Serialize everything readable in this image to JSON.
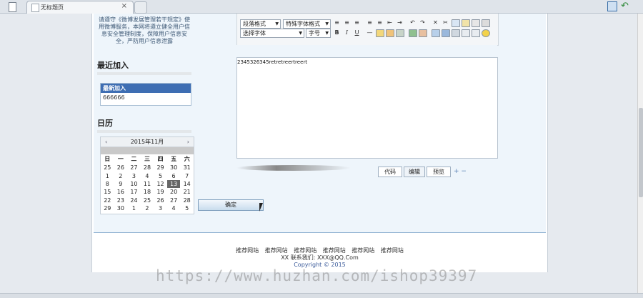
{
  "browser": {
    "tab_title": "无标题页",
    "tab_close": "×"
  },
  "left": {
    "notice": "请遵守《微博发展管理若干规定》使用微博服务，本网将遵立健全用户信息安全管理制度，保障用户信息安全，严防用户信息泄露",
    "recent_title": "最近加入",
    "recent_head": "最新加入",
    "recent_item": "666666",
    "calendar_title": "日历",
    "calendar": {
      "prev": "‹",
      "next": "›",
      "month": "2015年11月",
      "weekdays": [
        "日",
        "一",
        "二",
        "三",
        "四",
        "五",
        "六"
      ],
      "weeks": [
        [
          "25",
          "26",
          "27",
          "28",
          "29",
          "30",
          "31"
        ],
        [
          "1",
          "2",
          "3",
          "4",
          "5",
          "6",
          "7"
        ],
        [
          "8",
          "9",
          "10",
          "11",
          "12",
          "13",
          "14"
        ],
        [
          "15",
          "16",
          "17",
          "18",
          "19",
          "20",
          "21"
        ],
        [
          "22",
          "23",
          "24",
          "25",
          "26",
          "27",
          "28"
        ],
        [
          "29",
          "30",
          "1",
          "2",
          "3",
          "4",
          "5"
        ]
      ],
      "highlighted": "13"
    }
  },
  "editor": {
    "para_format": "段落格式",
    "special_format": "特殊字体格式",
    "font_select": "选择字体",
    "font_size": "字号",
    "bold": "B",
    "italic": "I",
    "underline": "U",
    "content": "2345326345retretreertreert",
    "tabs": [
      "代码",
      "编辑",
      "预览"
    ],
    "zoom": "+ −"
  },
  "submit_label": "确定",
  "footer": {
    "links": [
      "推荐网站",
      "推荐网站",
      "推荐网站",
      "推荐网站",
      "推荐网站",
      "推荐网站"
    ],
    "contact": "XX 联系我们: XXX@QQ.Com",
    "copyright": "Copyright © 2015"
  },
  "watermark": "https://www.huzhan.com/ishop39397"
}
